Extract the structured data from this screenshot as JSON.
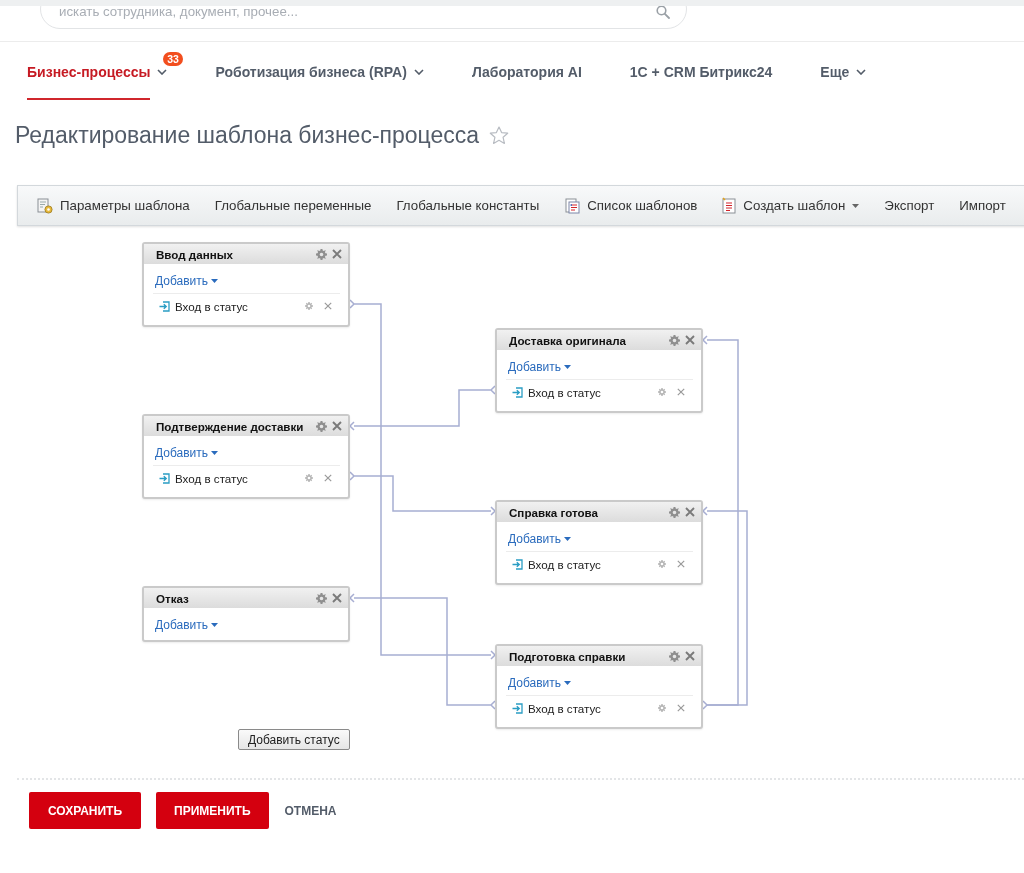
{
  "header": {
    "search": {
      "placeholder": "искать сотрудника, документ, прочее..."
    }
  },
  "nav": {
    "tabs": [
      {
        "label": "Бизнес-процессы",
        "selected": true,
        "has_menu": true,
        "badge": "33"
      },
      {
        "label": "Роботизация бизнеса (RPA)",
        "selected": false,
        "has_menu": true
      },
      {
        "label": "Лаборатория AI",
        "selected": false,
        "has_menu": false
      },
      {
        "label": "1С + CRM Битрикс24",
        "selected": false,
        "has_menu": false
      },
      {
        "label": "Еще",
        "selected": false,
        "has_menu": true
      }
    ]
  },
  "title": {
    "text": "Редактирование шаблона бизнес-процесса",
    "starred": false
  },
  "toolbar": {
    "items": [
      {
        "label": "Параметры шаблона",
        "kind": "settings",
        "has_menu": false
      },
      {
        "label": "Глобальные переменные",
        "kind": "plain",
        "has_menu": false
      },
      {
        "label": "Глобальные константы",
        "kind": "plain",
        "has_menu": false
      },
      {
        "label": "Список шаблонов",
        "kind": "list",
        "has_menu": false
      },
      {
        "label": "Создать шаблон",
        "kind": "create",
        "has_menu": true
      },
      {
        "label": "Экспорт",
        "kind": "plain",
        "has_menu": false
      },
      {
        "label": "Импорт",
        "kind": "plain",
        "has_menu": false
      }
    ]
  },
  "diagram": {
    "states": [
      {
        "title": "Ввод данных",
        "add_label": "Добавить",
        "events": [
          {
            "label": "Вход в статус"
          }
        ]
      },
      {
        "title": "Подтверждение доставки",
        "add_label": "Добавить",
        "events": [
          {
            "label": "Вход в статус"
          }
        ]
      },
      {
        "title": "Отказ",
        "add_label": "Добавить"
      },
      {
        "title": "Доставка оригинала",
        "add_label": "Добавить",
        "events": [
          {
            "label": "Вход в статус"
          }
        ]
      },
      {
        "title": "Справка готова",
        "add_label": "Добавить",
        "events": [
          {
            "label": "Вход в статус"
          }
        ]
      },
      {
        "title": "Подготовка справки",
        "add_label": "Добавить",
        "events": [
          {
            "label": "Вход в статус"
          }
        ]
      }
    ],
    "add_state_button": "Добавить статус"
  },
  "actions": [
    {
      "label": "СОХРАНИТЬ",
      "kind": "primary"
    },
    {
      "label": "ПРИМЕНИТЬ",
      "kind": "primary"
    },
    {
      "label": "ОТМЕНА",
      "kind": "link"
    }
  ]
}
